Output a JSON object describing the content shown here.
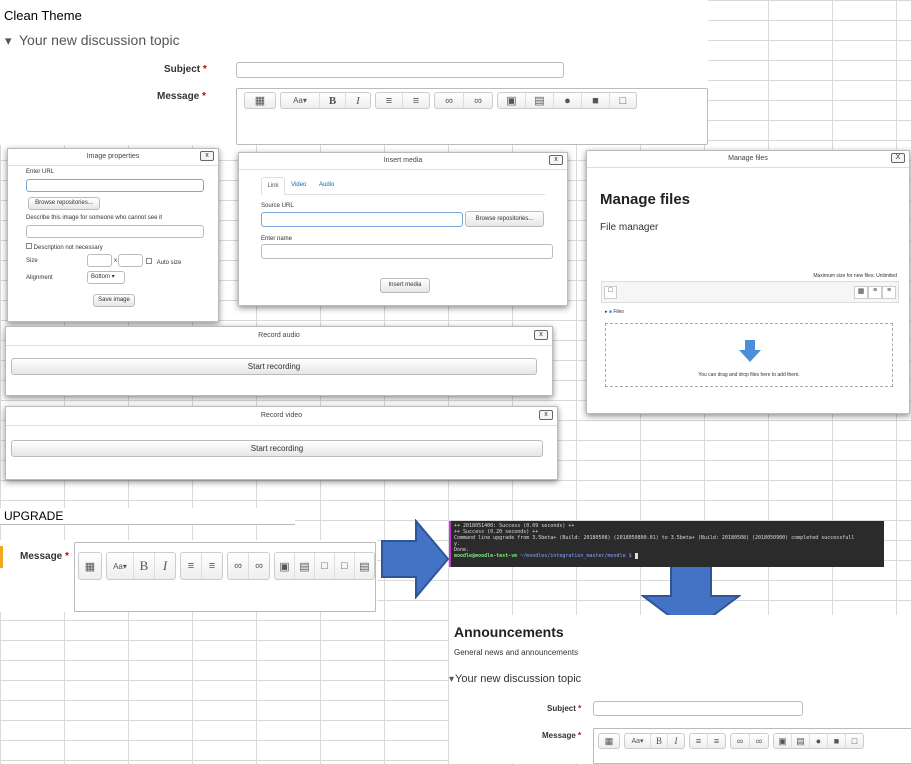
{
  "clean_theme_label": "Clean Theme",
  "top_form": {
    "topic": "Your new discussion topic",
    "subject_label": "Subject",
    "message_label": "Message",
    "required_mark": "*"
  },
  "image_properties": {
    "title": "Image properties",
    "close": "x",
    "enter_url": "Enter URL",
    "browse": "Browse repositories...",
    "describe": "Describe this image for someone who cannot see it",
    "desc_not_necessary": "Description not necessary",
    "size": "Size",
    "x": "x",
    "auto_size": "Auto size",
    "alignment": "Alignment",
    "alignment_value": "Bottom",
    "save": "Save image"
  },
  "insert_media": {
    "title": "Insert media",
    "close": "x",
    "tabs": [
      "Link",
      "Video",
      "Audio"
    ],
    "source_url": "Source URL",
    "browse": "Browse repositories...",
    "enter_name": "Enter name",
    "insert": "Insert media"
  },
  "manage_files": {
    "title": "Manage files",
    "close": "X",
    "heading": "Manage files",
    "file_manager": "File manager",
    "max_size": "Maximum size for new files: Unlimited",
    "files_label": "Files",
    "drop_text": "You can drag and drop files here to add them."
  },
  "record_audio": {
    "title": "Record audio",
    "close": "x",
    "start": "Start recording"
  },
  "record_video": {
    "title": "Record video",
    "close": "x",
    "start": "Start recording"
  },
  "upgrade_label": "UPGRADE",
  "upgrade_message_label": "Message",
  "terminal_lines": [
    "++ 2018051400: Success (0.09 seconds) ++",
    "++ Success (0.20 seconds) ++",
    "Command line upgrade from 3.5beta+ (Build: 20180508) (2018050800.01) to 3.5beta+ (Build: 20180508) (2018050900) completed successfull",
    "y.",
    "",
    "Done."
  ],
  "terminal_prompt_user": "moodle@moodle-test-vm",
  "terminal_prompt_path": " ~/moodles/integration_master/moodle $ ",
  "announcements": {
    "title": "Announcements",
    "subtitle": "General news and announcements",
    "topic": "Your new discussion topic",
    "subject_label": "Subject",
    "message_label": "Message"
  },
  "colors": {
    "arrow": "#4472c4",
    "arrow_border": "#2f5597",
    "accent": "#0070a8"
  }
}
